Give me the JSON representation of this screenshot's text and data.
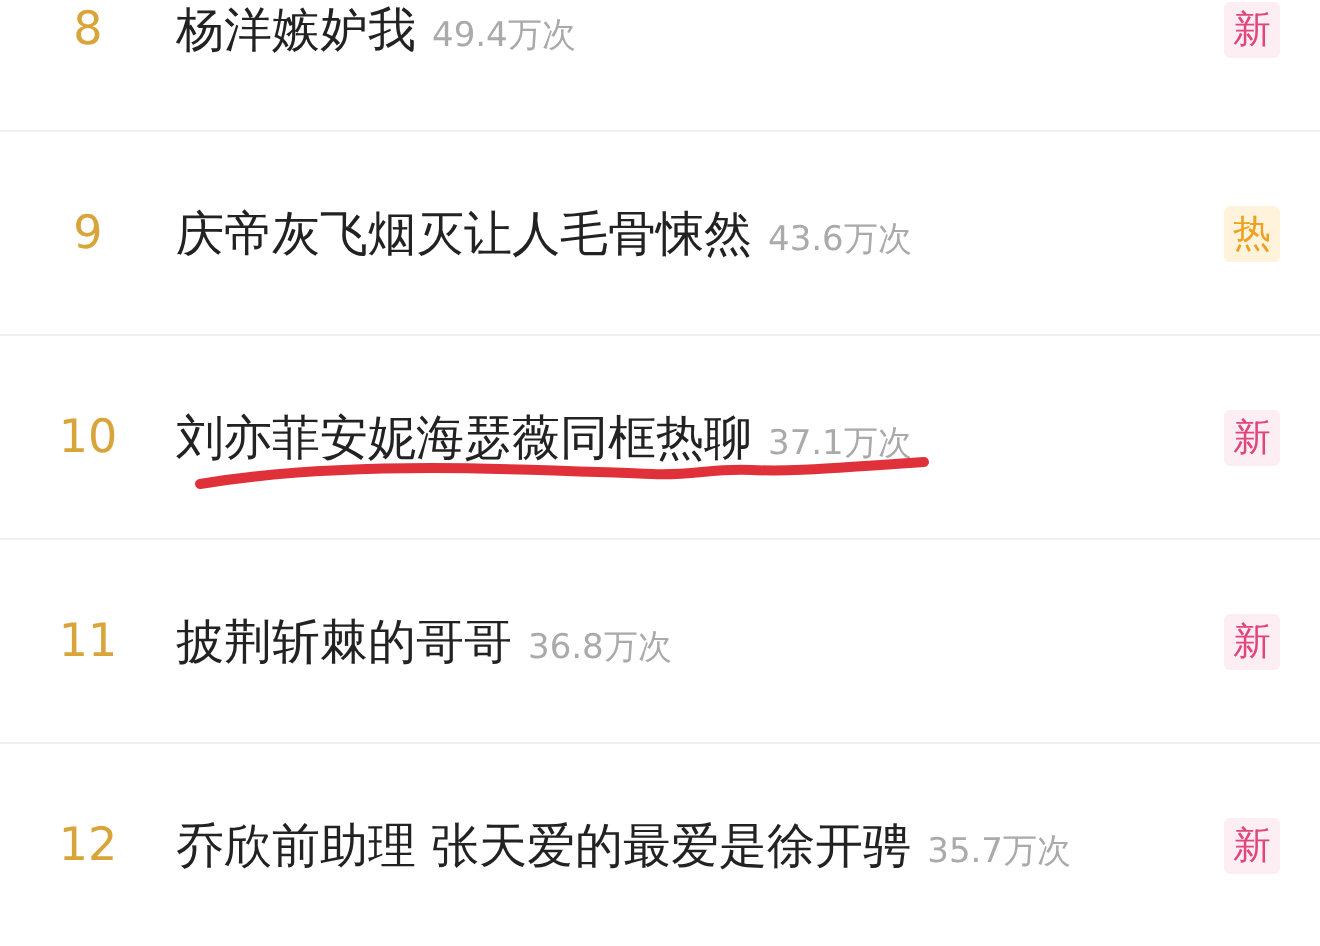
{
  "items": [
    {
      "rank": "8",
      "title": "杨洋嫉妒我",
      "count": "49.4万次",
      "badge": {
        "kind": "new",
        "label": "新"
      },
      "underlined": false
    },
    {
      "rank": "9",
      "title": "庆帝灰飞烟灭让人毛骨悚然",
      "count": "43.6万次",
      "badge": {
        "kind": "hot",
        "label": "热"
      },
      "underlined": false
    },
    {
      "rank": "10",
      "title": "刘亦菲安妮海瑟薇同框热聊",
      "count": "37.1万次",
      "badge": {
        "kind": "new",
        "label": "新"
      },
      "underlined": true
    },
    {
      "rank": "11",
      "title": "披荆斩棘的哥哥",
      "count": "36.8万次",
      "badge": {
        "kind": "new",
        "label": "新"
      },
      "underlined": false
    },
    {
      "rank": "12",
      "title": "乔欣前助理 张天爱的最爱是徐开骋",
      "count": "35.7万次",
      "badge": {
        "kind": "new",
        "label": "新"
      },
      "underlined": false
    }
  ]
}
